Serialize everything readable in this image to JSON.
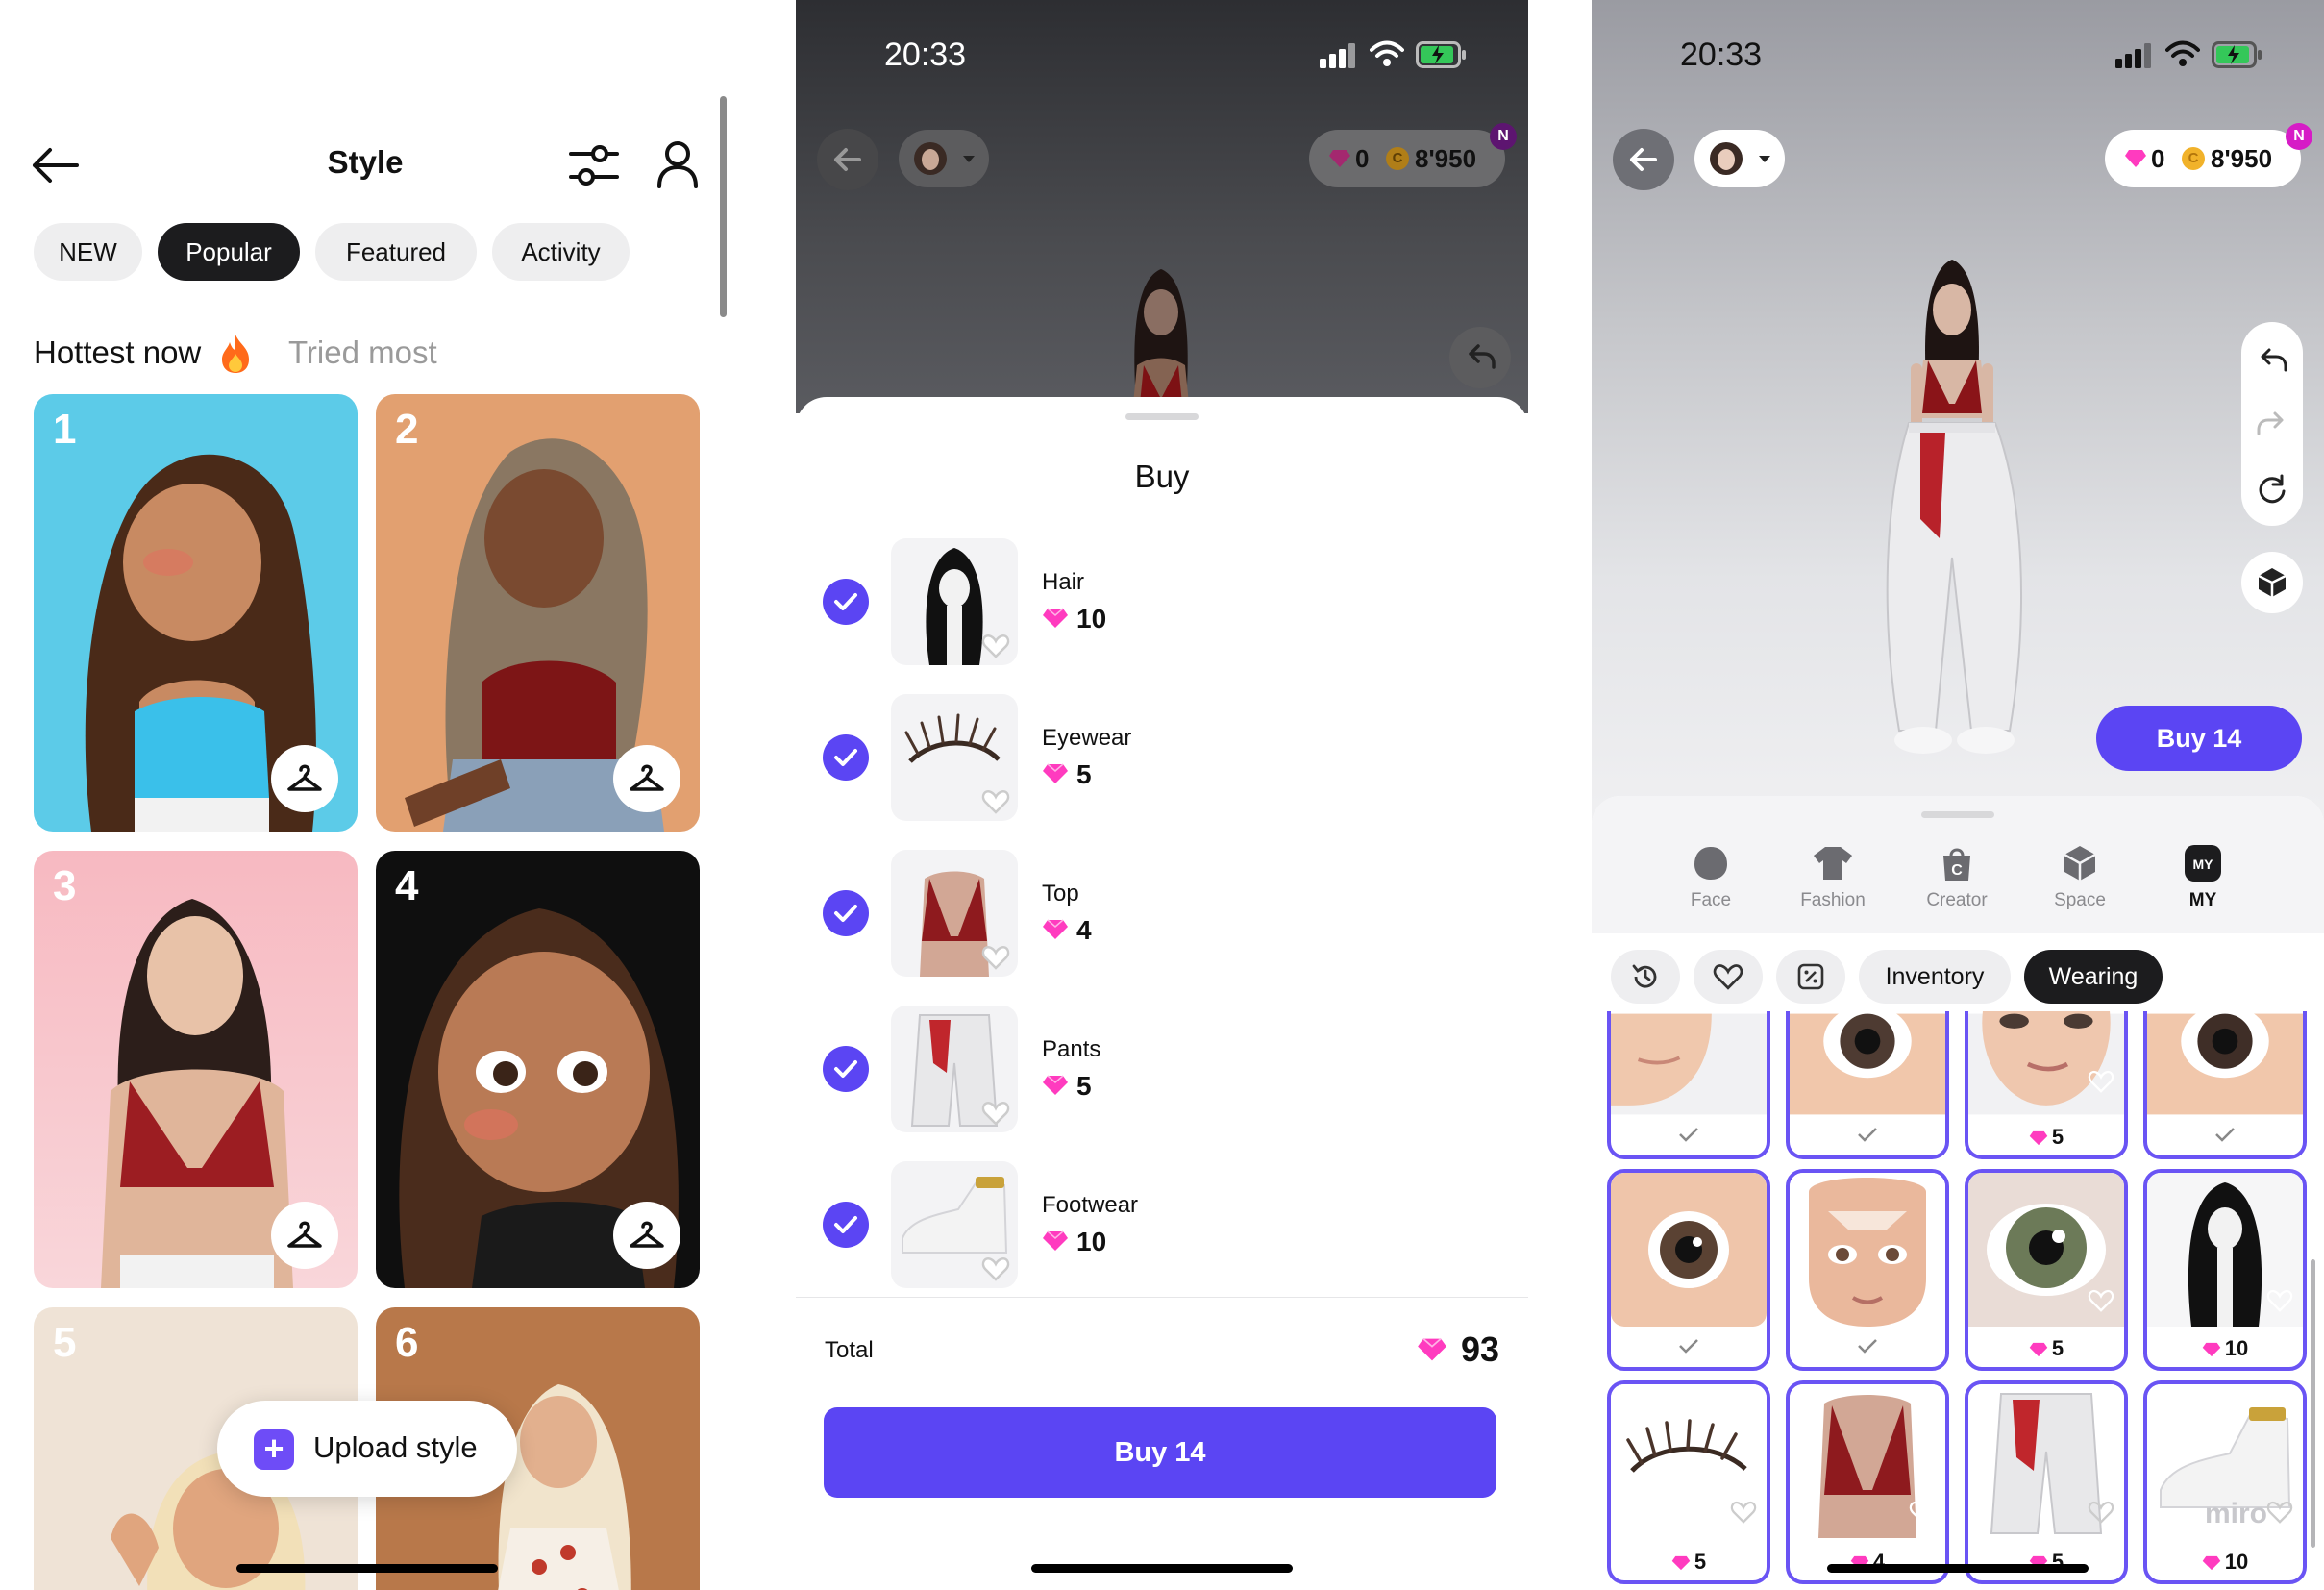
{
  "panel1": {
    "title": "Style",
    "chips": [
      "NEW",
      "Popular",
      "Featured",
      "Activity"
    ],
    "active_chip": "Popular",
    "subtabs": [
      "Hottest now",
      "Tried most"
    ],
    "cards": [
      {
        "rank": "1",
        "bg": "#5ccbe8"
      },
      {
        "rank": "2",
        "bg": "#e2a070"
      },
      {
        "rank": "3",
        "bg": "#f6c4c9"
      },
      {
        "rank": "4",
        "bg": "#0f0f0f"
      },
      {
        "rank": "5",
        "bg": "#efe3d6"
      },
      {
        "rank": "6",
        "bg": "#b8784a"
      }
    ],
    "upload_label": "Upload style"
  },
  "status": {
    "time": "20:33"
  },
  "currency": {
    "gems": "0",
    "coins": "8'950",
    "badge": "N"
  },
  "panel2": {
    "sheet_title": "Buy",
    "items": [
      {
        "label": "Hair",
        "price": "10"
      },
      {
        "label": "Eyewear",
        "price": "5"
      },
      {
        "label": "Top",
        "price": "4"
      },
      {
        "label": "Pants",
        "price": "5"
      },
      {
        "label": "Footwear",
        "price": "10"
      }
    ],
    "total_label": "Total",
    "total_value": "93",
    "buy_button": "Buy 14"
  },
  "panel3": {
    "buy_button": "Buy 14",
    "categories": [
      "Face",
      "Fashion",
      "Creator",
      "Space",
      "MY"
    ],
    "active_category": "MY",
    "my_badge": "MY",
    "tabs": [
      "Inventory",
      "Wearing"
    ],
    "active_tab": "Wearing",
    "grid": [
      [
        "",
        "",
        "5",
        ""
      ],
      [
        "",
        "",
        "5",
        "10"
      ],
      [
        "5",
        "4",
        "5",
        "10"
      ]
    ],
    "watermark": "miro"
  },
  "colors": {
    "accent": "#5b45f3",
    "gem": "#ff3bbf",
    "coin": "#f1b22a"
  }
}
